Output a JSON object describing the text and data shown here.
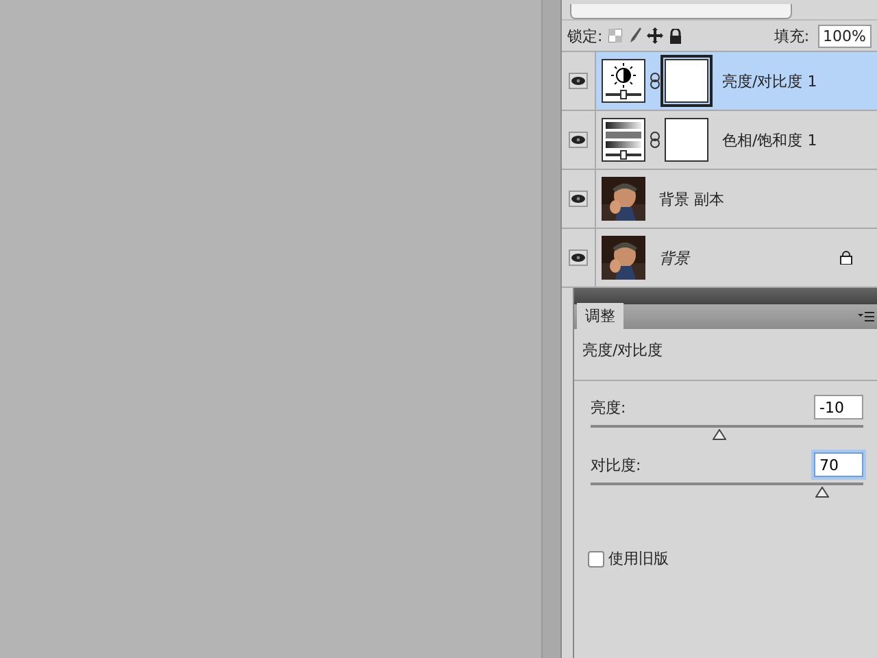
{
  "layers_panel": {
    "lock_label": "锁定:",
    "fill_label": "填充:",
    "fill_value": "100%",
    "layers": [
      {
        "name": "亮度/对比度 1",
        "kind": "brightness",
        "visible": true,
        "selected": true,
        "italic": false,
        "locked": false
      },
      {
        "name": "色相/饱和度 1",
        "kind": "hue",
        "visible": true,
        "selected": false,
        "italic": false,
        "locked": false
      },
      {
        "name": "背景 副本",
        "visible": true,
        "selected": false,
        "italic": false,
        "locked": false
      },
      {
        "name": "背景",
        "visible": true,
        "selected": false,
        "italic": true,
        "locked": true
      }
    ]
  },
  "adjustments_panel": {
    "tab": "调整",
    "title": "亮度/对比度",
    "sliders": [
      {
        "label": "亮度:",
        "value": "-10",
        "level": 0.47,
        "focused": false
      },
      {
        "label": "对比度:",
        "value": "70",
        "level": 0.85,
        "focused": true
      }
    ],
    "legacy": {
      "label": "使用旧版",
      "checked": false
    }
  }
}
